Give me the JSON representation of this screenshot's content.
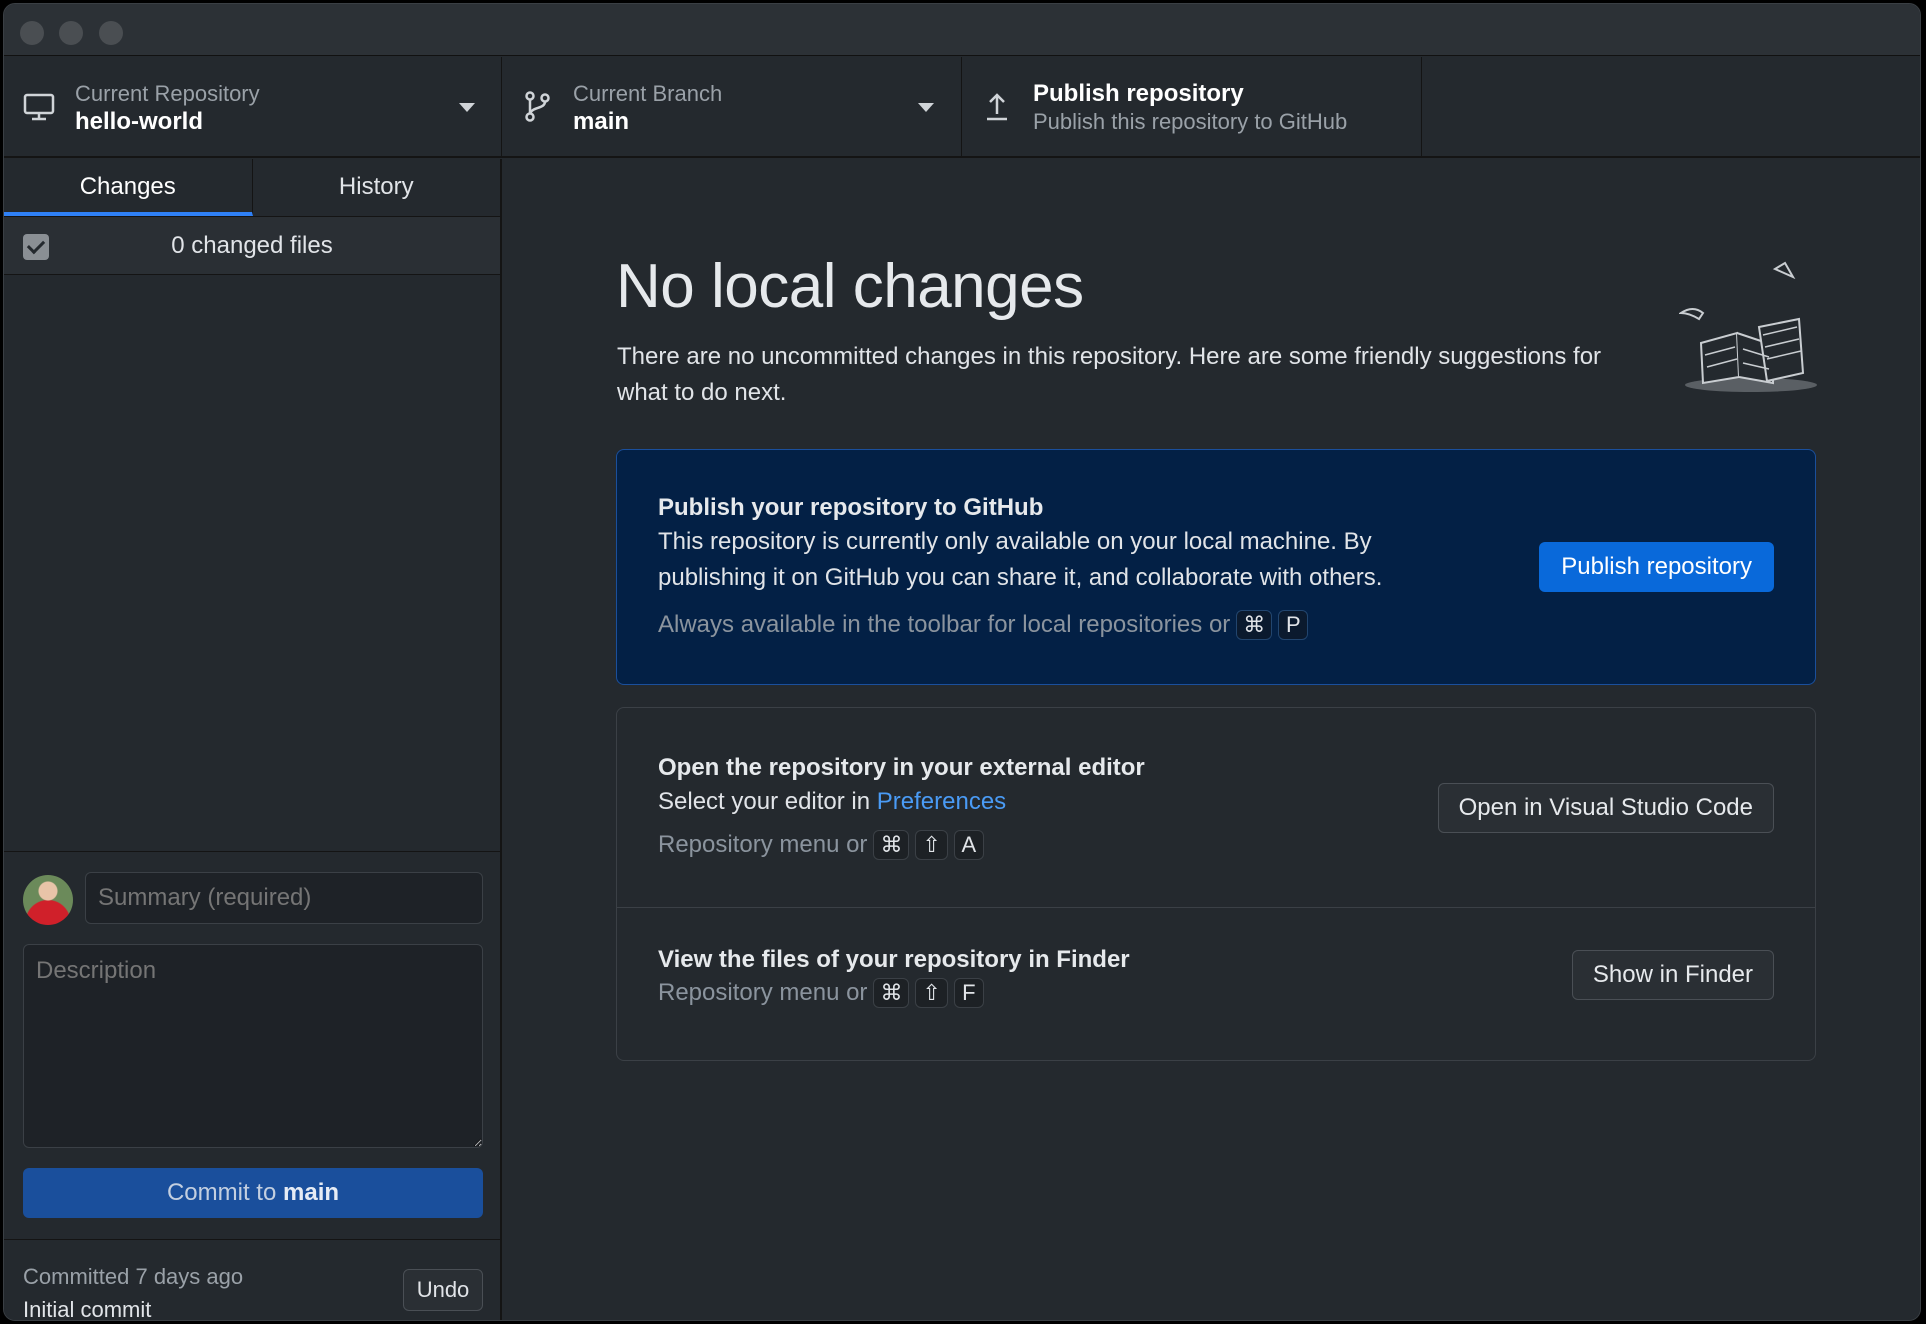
{
  "toolbar": {
    "repo": {
      "label": "Current Repository",
      "value": "hello-world"
    },
    "branch": {
      "label": "Current Branch",
      "value": "main"
    },
    "publish": {
      "title": "Publish repository",
      "subtitle": "Publish this repository to GitHub"
    }
  },
  "sidebar": {
    "tabs": [
      {
        "label": "Changes",
        "active": true
      },
      {
        "label": "History",
        "active": false
      }
    ],
    "changed_files": "0 changed files",
    "summary_placeholder": "Summary (required)",
    "description_placeholder": "Description",
    "commit_prefix": "Commit to",
    "commit_branch": "main",
    "last_commit": {
      "time": "Committed 7 days ago",
      "message": "Initial commit",
      "undo_label": "Undo"
    }
  },
  "main": {
    "headline": "No local changes",
    "intro": "There are no uncommitted changes in this repository. Here are some friendly suggestions for what to do next.",
    "publish_card": {
      "title": "Publish your repository to GitHub",
      "body": "This repository is currently only available on your local machine. By publishing it on GitHub you can share it, and collaborate with others.",
      "hint": "Always available in the toolbar for local repositories or",
      "keys": [
        "⌘",
        "P"
      ],
      "button": "Publish repository"
    },
    "editor_card": {
      "title": "Open the repository in your external editor",
      "body_prefix": "Select your editor in",
      "body_link": "Preferences",
      "hint": "Repository menu or",
      "keys": [
        "⌘",
        "⇧",
        "A"
      ],
      "button": "Open in Visual Studio Code"
    },
    "finder_card": {
      "title": "View the files of your repository in Finder",
      "hint": "Repository menu or",
      "keys": [
        "⌘",
        "⇧",
        "F"
      ],
      "button": "Show in Finder"
    }
  },
  "colors": {
    "accent": "#0969da",
    "background": "#24292e",
    "publish_card": "#032045"
  }
}
